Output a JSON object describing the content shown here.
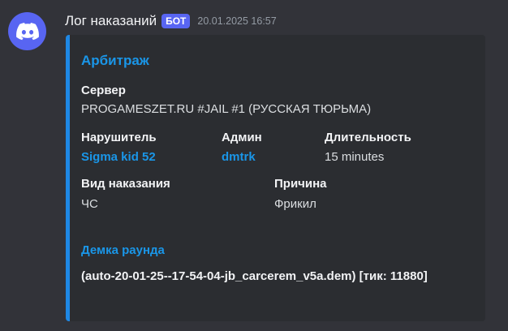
{
  "message": {
    "author": "Лог наказаний",
    "bot_tag": "БОТ",
    "timestamp": "20.01.2025 16:57",
    "avatar_icon": "discord-logo-icon"
  },
  "embed": {
    "accent_color": "#1e88e5",
    "title": "Арбитраж",
    "fields": {
      "server": {
        "name": "Сервер",
        "value": "PROGAMESZET.RU #JAIL #1 (РУССКАЯ ТЮРЬМА)"
      },
      "violator": {
        "name": "Нарушитель",
        "value": "Sigma kid 52"
      },
      "admin": {
        "name": "Админ",
        "value": "dmtrk"
      },
      "duration": {
        "name": "Длительность",
        "value": "15 minutes"
      },
      "punishment_type": {
        "name": "Вид наказания",
        "value": "ЧС"
      },
      "reason": {
        "name": "Причина",
        "value": "Фрикил"
      },
      "demo": {
        "name": "Демка раунда",
        "value": "(auto-20-01-25--17-54-04-jb_carcerem_v5a.dem) [тик: 11880]"
      }
    }
  }
}
